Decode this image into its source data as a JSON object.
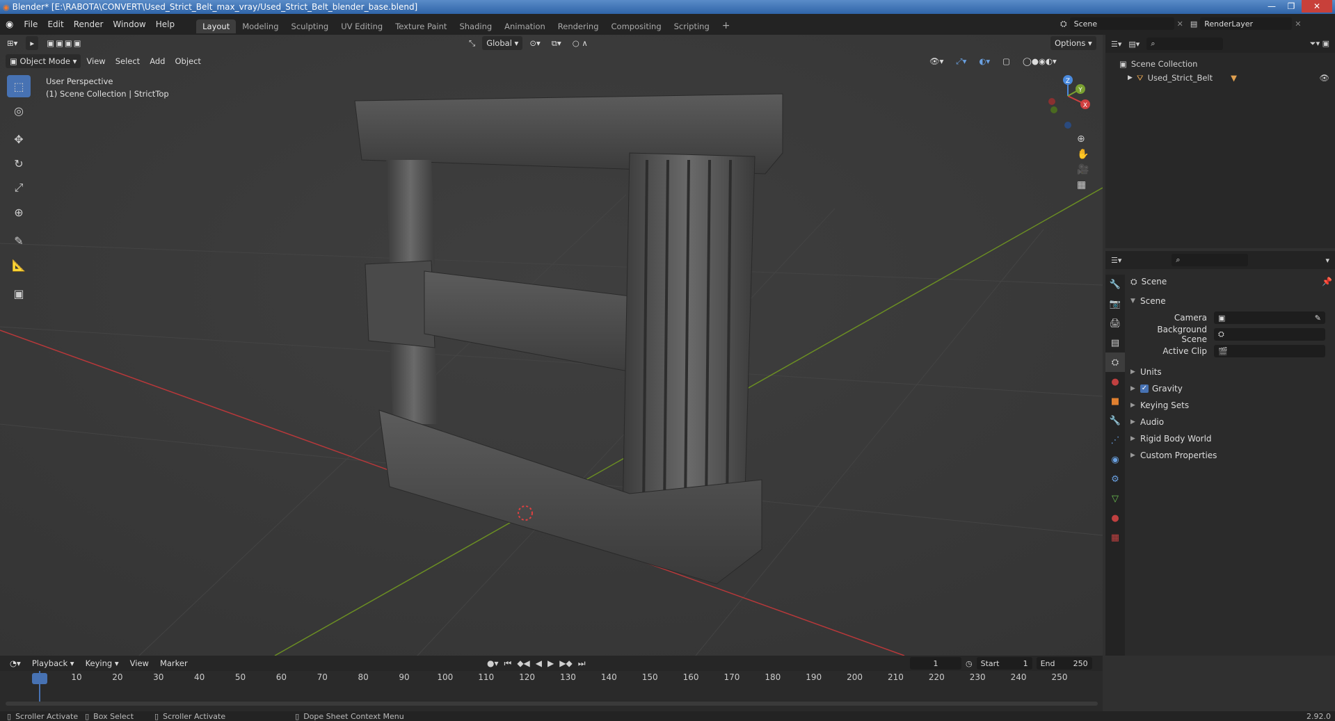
{
  "window": {
    "title": "Blender* [E:\\RABOTA\\CONVERT\\Used_Strict_Belt_max_vray/Used_Strict_Belt_blender_base.blend]"
  },
  "menu": [
    "File",
    "Edit",
    "Render",
    "Window",
    "Help"
  ],
  "workspaces": [
    "Layout",
    "Modeling",
    "Sculpting",
    "UV Editing",
    "Texture Paint",
    "Shading",
    "Animation",
    "Rendering",
    "Compositing",
    "Scripting"
  ],
  "active_workspace": "Layout",
  "scene_field": "Scene",
  "renderlayer_field": "RenderLayer",
  "viewport": {
    "mode": "Object Mode",
    "menus": [
      "View",
      "Select",
      "Add",
      "Object"
    ],
    "transform_orientation": "Global",
    "options_label": "Options",
    "overlay_line1": "User Perspective",
    "overlay_line2": "(1) Scene Collection | StrictTop",
    "gizmo": {
      "x": "X",
      "y": "Y",
      "z": "Z"
    }
  },
  "outliner": {
    "root": "Scene Collection",
    "items": [
      "Used_Strict_Belt"
    ]
  },
  "properties": {
    "context": "Scene",
    "panel": "Scene",
    "fields": [
      {
        "label": "Camera",
        "value": ""
      },
      {
        "label": "Background Scene",
        "value": ""
      },
      {
        "label": "Active Clip",
        "value": ""
      }
    ],
    "subpanels": [
      "Units",
      "Gravity",
      "Keying Sets",
      "Audio",
      "Rigid Body World",
      "Custom Properties"
    ],
    "gravity_checked": true
  },
  "timeline": {
    "menus": [
      "Playback",
      "Keying",
      "View",
      "Marker"
    ],
    "current_frame": "1",
    "start_label": "Start",
    "start_value": "1",
    "end_label": "End",
    "end_value": "250",
    "ruler": [
      "1",
      "10",
      "20",
      "30",
      "40",
      "50",
      "60",
      "70",
      "80",
      "90",
      "100",
      "110",
      "120",
      "130",
      "140",
      "150",
      "160",
      "170",
      "180",
      "190",
      "200",
      "210",
      "220",
      "230",
      "240",
      "250"
    ]
  },
  "status": {
    "items": [
      "Scroller Activate",
      "Box Select",
      "Scroller Activate",
      "Dope Sheet Context Menu"
    ],
    "version": "2.92.0"
  },
  "colors": {
    "accent": "#4772b3",
    "x_axis": "#c0392b",
    "y_axis": "#6b8e23"
  }
}
